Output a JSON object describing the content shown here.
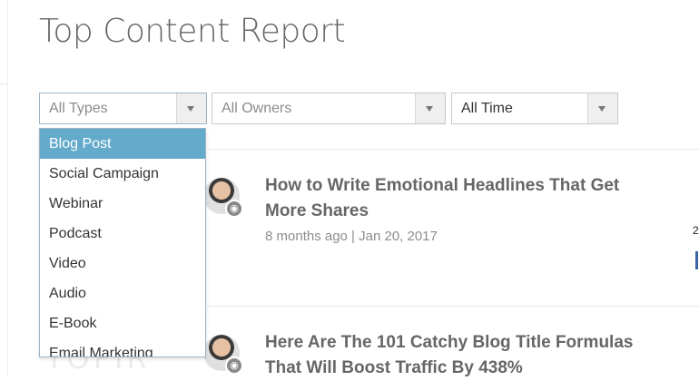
{
  "page": {
    "title": "Top Content Report"
  },
  "filters": {
    "type": {
      "value": "All Types"
    },
    "owner": {
      "value": "All Owners"
    },
    "time": {
      "value": "All Time"
    }
  },
  "type_dropdown": {
    "options": [
      "Blog Post",
      "Social Campaign",
      "Webinar",
      "Podcast",
      "Video",
      "Audio",
      "E-Book",
      "Email Marketing"
    ],
    "highlighted": "Blog Post"
  },
  "content_items": [
    {
      "title": "How to Write Emotional Headlines That Get More Shares",
      "meta": "8 months ago | Jan 20, 2017",
      "badge_icon": "rss-icon"
    },
    {
      "title": "Here Are The 101 Catchy Blog Title Formulas That Will Boost Traffic By 438%",
      "meta": "",
      "badge_icon": "rss-icon"
    }
  ],
  "edge": {
    "number": "2"
  },
  "colors": {
    "highlight": "#63aacb",
    "title": "#666666",
    "meta": "#8d8d8d",
    "edge_bar": "#3a66a8"
  }
}
